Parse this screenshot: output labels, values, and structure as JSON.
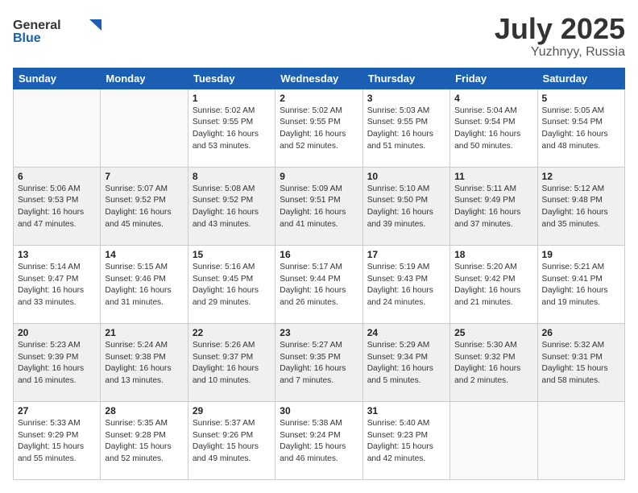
{
  "logo": {
    "text_general": "General",
    "text_blue": "Blue"
  },
  "header": {
    "month": "July 2025",
    "location": "Yuzhnyy, Russia"
  },
  "days_of_week": [
    "Sunday",
    "Monday",
    "Tuesday",
    "Wednesday",
    "Thursday",
    "Friday",
    "Saturday"
  ],
  "weeks": [
    [
      {
        "day": "",
        "content": ""
      },
      {
        "day": "",
        "content": ""
      },
      {
        "day": "1",
        "content": "Sunrise: 5:02 AM\nSunset: 9:55 PM\nDaylight: 16 hours\nand 53 minutes."
      },
      {
        "day": "2",
        "content": "Sunrise: 5:02 AM\nSunset: 9:55 PM\nDaylight: 16 hours\nand 52 minutes."
      },
      {
        "day": "3",
        "content": "Sunrise: 5:03 AM\nSunset: 9:55 PM\nDaylight: 16 hours\nand 51 minutes."
      },
      {
        "day": "4",
        "content": "Sunrise: 5:04 AM\nSunset: 9:54 PM\nDaylight: 16 hours\nand 50 minutes."
      },
      {
        "day": "5",
        "content": "Sunrise: 5:05 AM\nSunset: 9:54 PM\nDaylight: 16 hours\nand 48 minutes."
      }
    ],
    [
      {
        "day": "6",
        "content": "Sunrise: 5:06 AM\nSunset: 9:53 PM\nDaylight: 16 hours\nand 47 minutes."
      },
      {
        "day": "7",
        "content": "Sunrise: 5:07 AM\nSunset: 9:52 PM\nDaylight: 16 hours\nand 45 minutes."
      },
      {
        "day": "8",
        "content": "Sunrise: 5:08 AM\nSunset: 9:52 PM\nDaylight: 16 hours\nand 43 minutes."
      },
      {
        "day": "9",
        "content": "Sunrise: 5:09 AM\nSunset: 9:51 PM\nDaylight: 16 hours\nand 41 minutes."
      },
      {
        "day": "10",
        "content": "Sunrise: 5:10 AM\nSunset: 9:50 PM\nDaylight: 16 hours\nand 39 minutes."
      },
      {
        "day": "11",
        "content": "Sunrise: 5:11 AM\nSunset: 9:49 PM\nDaylight: 16 hours\nand 37 minutes."
      },
      {
        "day": "12",
        "content": "Sunrise: 5:12 AM\nSunset: 9:48 PM\nDaylight: 16 hours\nand 35 minutes."
      }
    ],
    [
      {
        "day": "13",
        "content": "Sunrise: 5:14 AM\nSunset: 9:47 PM\nDaylight: 16 hours\nand 33 minutes."
      },
      {
        "day": "14",
        "content": "Sunrise: 5:15 AM\nSunset: 9:46 PM\nDaylight: 16 hours\nand 31 minutes."
      },
      {
        "day": "15",
        "content": "Sunrise: 5:16 AM\nSunset: 9:45 PM\nDaylight: 16 hours\nand 29 minutes."
      },
      {
        "day": "16",
        "content": "Sunrise: 5:17 AM\nSunset: 9:44 PM\nDaylight: 16 hours\nand 26 minutes."
      },
      {
        "day": "17",
        "content": "Sunrise: 5:19 AM\nSunset: 9:43 PM\nDaylight: 16 hours\nand 24 minutes."
      },
      {
        "day": "18",
        "content": "Sunrise: 5:20 AM\nSunset: 9:42 PM\nDaylight: 16 hours\nand 21 minutes."
      },
      {
        "day": "19",
        "content": "Sunrise: 5:21 AM\nSunset: 9:41 PM\nDaylight: 16 hours\nand 19 minutes."
      }
    ],
    [
      {
        "day": "20",
        "content": "Sunrise: 5:23 AM\nSunset: 9:39 PM\nDaylight: 16 hours\nand 16 minutes."
      },
      {
        "day": "21",
        "content": "Sunrise: 5:24 AM\nSunset: 9:38 PM\nDaylight: 16 hours\nand 13 minutes."
      },
      {
        "day": "22",
        "content": "Sunrise: 5:26 AM\nSunset: 9:37 PM\nDaylight: 16 hours\nand 10 minutes."
      },
      {
        "day": "23",
        "content": "Sunrise: 5:27 AM\nSunset: 9:35 PM\nDaylight: 16 hours\nand 7 minutes."
      },
      {
        "day": "24",
        "content": "Sunrise: 5:29 AM\nSunset: 9:34 PM\nDaylight: 16 hours\nand 5 minutes."
      },
      {
        "day": "25",
        "content": "Sunrise: 5:30 AM\nSunset: 9:32 PM\nDaylight: 16 hours\nand 2 minutes."
      },
      {
        "day": "26",
        "content": "Sunrise: 5:32 AM\nSunset: 9:31 PM\nDaylight: 15 hours\nand 58 minutes."
      }
    ],
    [
      {
        "day": "27",
        "content": "Sunrise: 5:33 AM\nSunset: 9:29 PM\nDaylight: 15 hours\nand 55 minutes."
      },
      {
        "day": "28",
        "content": "Sunrise: 5:35 AM\nSunset: 9:28 PM\nDaylight: 15 hours\nand 52 minutes."
      },
      {
        "day": "29",
        "content": "Sunrise: 5:37 AM\nSunset: 9:26 PM\nDaylight: 15 hours\nand 49 minutes."
      },
      {
        "day": "30",
        "content": "Sunrise: 5:38 AM\nSunset: 9:24 PM\nDaylight: 15 hours\nand 46 minutes."
      },
      {
        "day": "31",
        "content": "Sunrise: 5:40 AM\nSunset: 9:23 PM\nDaylight: 15 hours\nand 42 minutes."
      },
      {
        "day": "",
        "content": ""
      },
      {
        "day": "",
        "content": ""
      }
    ]
  ]
}
